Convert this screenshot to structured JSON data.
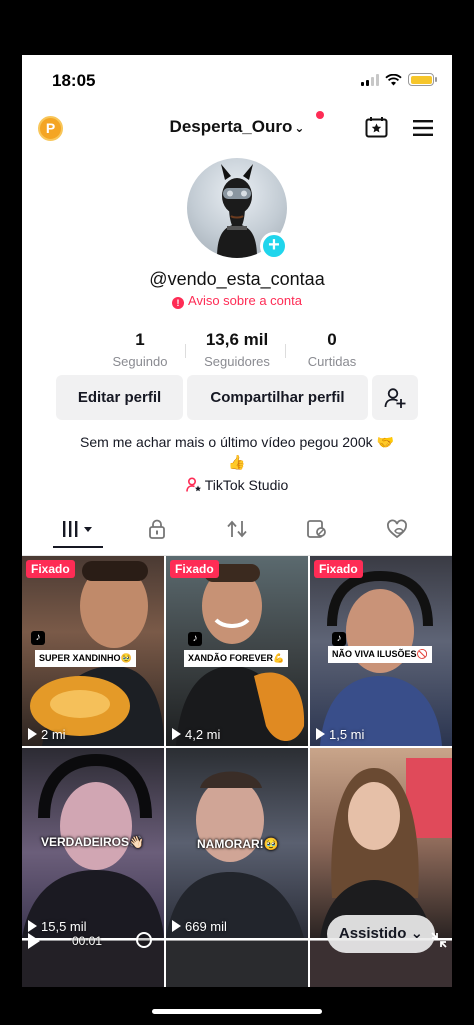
{
  "status_bar": {
    "time": "18:05"
  },
  "header": {
    "username": "Desperta_Ouro",
    "chevron": "⌄",
    "coin_label": "P"
  },
  "profile": {
    "handle": "@vendo_esta_contaa",
    "warning": "Aviso sobre a conta",
    "stats": [
      {
        "value": "1",
        "label": "Seguindo"
      },
      {
        "value": "13,6 mil",
        "label": "Seguidores"
      },
      {
        "value": "0",
        "label": "Curtidas"
      }
    ],
    "buttons": {
      "edit": "Editar perfil",
      "share": "Compartilhar perfil"
    },
    "bio_line1": "Sem me achar mais o último vídeo pegou 200k 🤝",
    "bio_line2": "👍",
    "studio": "TikTok Studio"
  },
  "tabs": [
    "videos-icon",
    "lock-icon",
    "repost-icon",
    "tagged-icon",
    "liked-icon"
  ],
  "videos": [
    {
      "pinned": "Fixado",
      "caption": "SUPER XANDINHO🥹",
      "views": "2 mi"
    },
    {
      "pinned": "Fixado",
      "caption": "XANDÃO FOREVER💪",
      "views": "4,2 mi"
    },
    {
      "pinned": "Fixado",
      "caption": "NÃO VIVA ILUSÕES🚫",
      "views": "1,5 mi"
    },
    {
      "pinned": "",
      "caption": "VERDADEIROS👋🏻",
      "views": "15,5 mil"
    },
    {
      "pinned": "",
      "caption": "NAMORAR!🥹",
      "views": "669 mil"
    },
    {
      "pinned": "",
      "caption": "",
      "views": ""
    }
  ],
  "player": {
    "time": "00:01",
    "watched": "Assistido ⌄"
  },
  "colors": {
    "accent": "#fe2c55",
    "badge": "#20d5ec",
    "coin": "#f4a523",
    "battery": "#f6c62b"
  }
}
